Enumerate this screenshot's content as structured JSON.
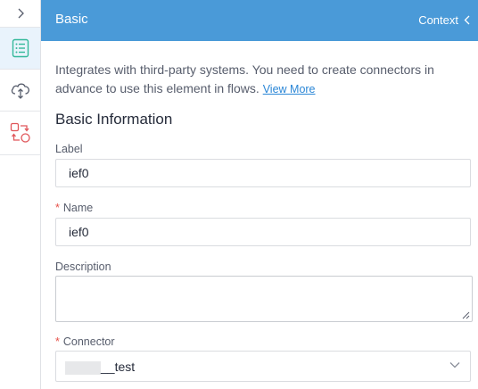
{
  "header": {
    "title": "Basic",
    "context_label": "Context"
  },
  "description": {
    "text": "Integrates with third-party systems. You need to create connectors in advance to use this element in flows.",
    "link": "View More"
  },
  "section": {
    "title": "Basic Information"
  },
  "fields": {
    "label": {
      "label": "Label",
      "value": "ief0"
    },
    "name": {
      "label": "Name",
      "value": "ief0",
      "required": "*"
    },
    "description": {
      "label": "Description",
      "value": ""
    },
    "connector": {
      "label": "Connector",
      "value": "__test",
      "required": "*"
    }
  },
  "colors": {
    "header_bg": "#4a9ad8",
    "link": "#2a86d6",
    "required": "#e6524a",
    "active_rail_bg": "#e9f3fc",
    "icon_green": "#33b89a",
    "icon_red": "#e0565a"
  },
  "icons": {
    "rail_toggle": "chevron-right-icon",
    "rail_basic": "list-document-icon",
    "rail_cloud": "cloud-sync-icon",
    "rail_convert": "convert-icon",
    "context": "chevron-left-icon",
    "select": "chevron-down-icon"
  }
}
